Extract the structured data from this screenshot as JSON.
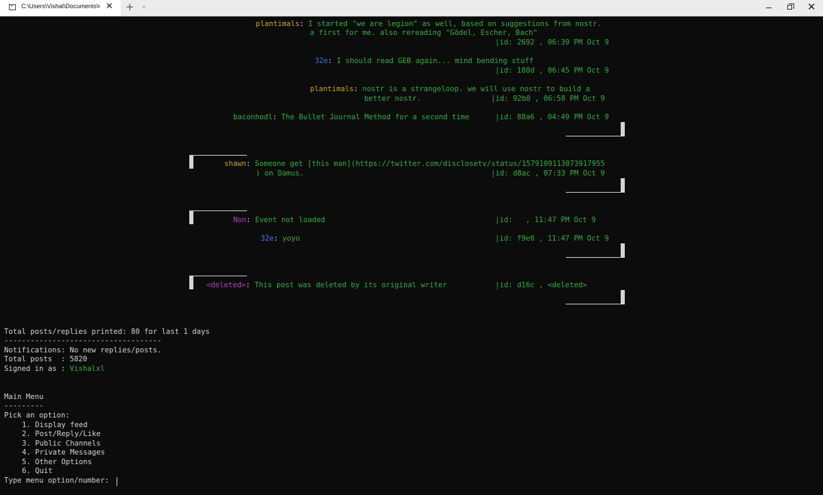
{
  "window": {
    "tab_title": "C:\\Users\\Vishal\\Documents\\Gi",
    "tab_close": "✕",
    "new_tab": "+",
    "dropdown": "⌄",
    "close": "✕"
  },
  "posts": [
    {
      "author": "plantimals",
      "sep": ": ",
      "line1": "I started \"we are legion\" as well, based on suggestions from nostr.",
      "line2": "a first for me. also rereading \"Gödel, Escher, Bach\"",
      "meta": "|id: 2692 , 06:39 PM Oct 9"
    },
    {
      "author": "32e",
      "sep": ": ",
      "line1": "I should read GEB again... mind bending stuff",
      "meta": "|id: 188d , 06:45 PM Oct 9"
    },
    {
      "author": "plantimals",
      "sep": ": ",
      "line1": "nostr is a strangeloop. we will use nostr to build a",
      "line2": "better nostr.",
      "meta": "|id: 92b0 , 06:58 PM Oct 9"
    },
    {
      "author": "baconhodl",
      "sep": ": ",
      "line1": "The Bullet Journal Method for a second time",
      "meta": "|id: 88a6 , 04:49 PM Oct 9"
    },
    {
      "author": "shawn",
      "sep": ": ",
      "line1": "Someone get [this man](https://twitter.com/disclosetv/status/1579109113073917955",
      "line2": ") on Damus.",
      "meta": "|id: d8ac , 07:33 PM Oct 9"
    },
    {
      "author": "Non",
      "sep": ": ",
      "line1": "Event not loaded",
      "meta": "|id:   , 11:47 PM Oct 9"
    },
    {
      "author": "32e",
      "sep": ": ",
      "line1": "yoyo",
      "meta": "|id: f9e0 , 11:47 PM Oct 9"
    },
    {
      "author": "<deleted>",
      "sep": ": ",
      "line1": "This post was deleted by its original writer",
      "meta": "|id: d16c , <deleted>"
    }
  ],
  "summary": {
    "total_printed": "Total posts/replies printed: 80 for last 1 days",
    "divider": "------------------------------------",
    "notifications": "Notifications: No new replies/posts.",
    "total_posts": "Total posts  : 5820",
    "signed_in_label": "Signed in as : ",
    "signed_in_user": "Vishalxl"
  },
  "menu": {
    "title": "Main Menu",
    "divider": "---------",
    "prompt": "Pick an option:",
    "options": [
      "1. Display feed",
      "2. Post/Reply/Like",
      "3. Public Channels",
      "4. Private Messages",
      "5. Other Options",
      "6. Quit"
    ],
    "input_prompt": "Type menu option/number: "
  },
  "colors": {
    "background": "#0c0c0c",
    "text": "#d4d4d4",
    "post_text": "#2fb43a",
    "author_yellow": "#d4a418",
    "author_blue": "#3b78ff",
    "author_magenta": "#bc3fbc"
  }
}
